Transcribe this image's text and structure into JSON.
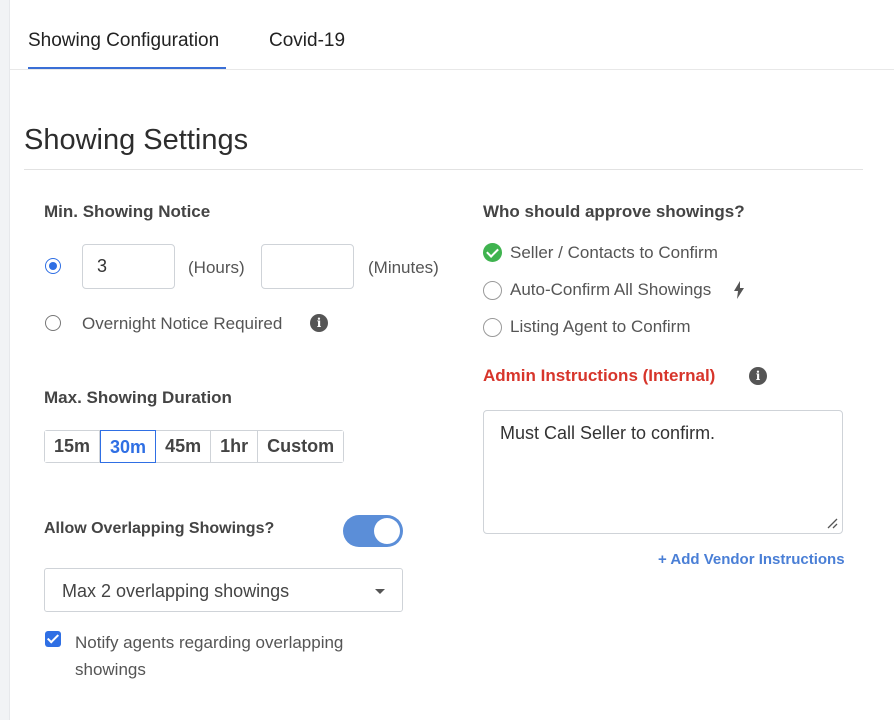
{
  "tabs": [
    {
      "label": "Showing Configuration",
      "active": true
    },
    {
      "label": "Covid-19",
      "active": false
    }
  ],
  "section_title": "Showing Settings",
  "min_notice": {
    "label": "Min. Showing Notice",
    "hours_value": "3",
    "hours_unit": "(Hours)",
    "minutes_value": "",
    "minutes_unit": "(Minutes)",
    "overnight_label": "Overnight Notice Required",
    "selected_option": "hours"
  },
  "max_duration": {
    "label": "Max. Showing Duration",
    "options": [
      "15m",
      "30m",
      "45m",
      "1hr",
      "Custom"
    ],
    "selected": "30m"
  },
  "overlap": {
    "label": "Allow Overlapping Showings?",
    "enabled": true,
    "select_value": "Max 2 overlapping showings",
    "notify_label": "Notify agents regarding overlapping showings",
    "notify_checked": true
  },
  "approval": {
    "label": "Who should approve showings?",
    "options": [
      {
        "label": "Seller / Contacts to Confirm",
        "selected": true
      },
      {
        "label": "Auto-Confirm All Showings",
        "selected": false
      },
      {
        "label": "Listing Agent to Confirm",
        "selected": false
      }
    ]
  },
  "admin": {
    "label": "Admin Instructions (Internal)",
    "value": "Must Call Seller to confirm.",
    "vendor_link": "+ Add Vendor Instructions"
  },
  "colors": {
    "accent": "#2f6fe4",
    "danger": "#d7352b",
    "success": "#3fb34f",
    "toggle": "#5b8ed8"
  }
}
